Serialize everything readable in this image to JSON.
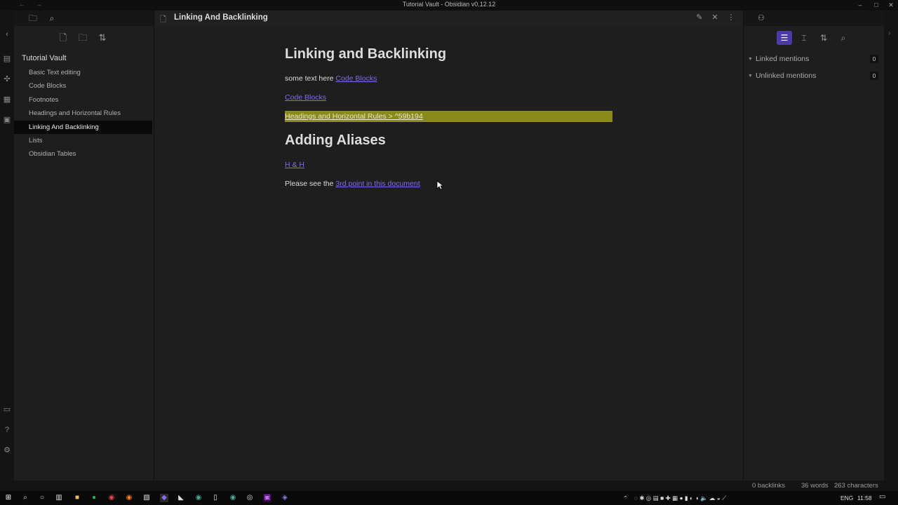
{
  "window": {
    "title": "Tutorial Vault - Obsidian v0.12.12"
  },
  "left_sidebar": {
    "vault_name": "Tutorial Vault",
    "files": [
      {
        "label": "Basic Text editing",
        "active": false
      },
      {
        "label": "Code Blocks",
        "active": false
      },
      {
        "label": "Footnotes",
        "active": false
      },
      {
        "label": "Headings and Horizontal Rules",
        "active": false
      },
      {
        "label": "Linking And Backlinking",
        "active": true
      },
      {
        "label": "Lists",
        "active": false
      },
      {
        "label": "Obsidian Tables",
        "active": false
      }
    ]
  },
  "editor": {
    "tab_title": "Linking And Backlinking",
    "h1": "Linking and Backlinking",
    "line1_text": "some text here ",
    "line1_link": "Code Blocks",
    "line2_link": "Code Blocks",
    "highlight_link": "Headings and Horizontal Rules > ^59b194",
    "h2": "Adding Aliases",
    "alias_link": "H & H",
    "line3_text": "Please see the ",
    "line3_link": "3rd point in this document"
  },
  "right_sidebar": {
    "linked_mentions": {
      "label": "Linked mentions",
      "count": "0"
    },
    "unlinked_mentions": {
      "label": "Unlinked mentions",
      "count": "0"
    }
  },
  "status_bar": {
    "backlinks": "0 backlinks",
    "words": "36 words",
    "characters": "263 characters"
  },
  "taskbar": {
    "language": "ENG",
    "time": "11:58"
  },
  "colors": {
    "accent": "#7f6df2",
    "highlight": "#8a8a18",
    "background": "#1e1e1e"
  }
}
